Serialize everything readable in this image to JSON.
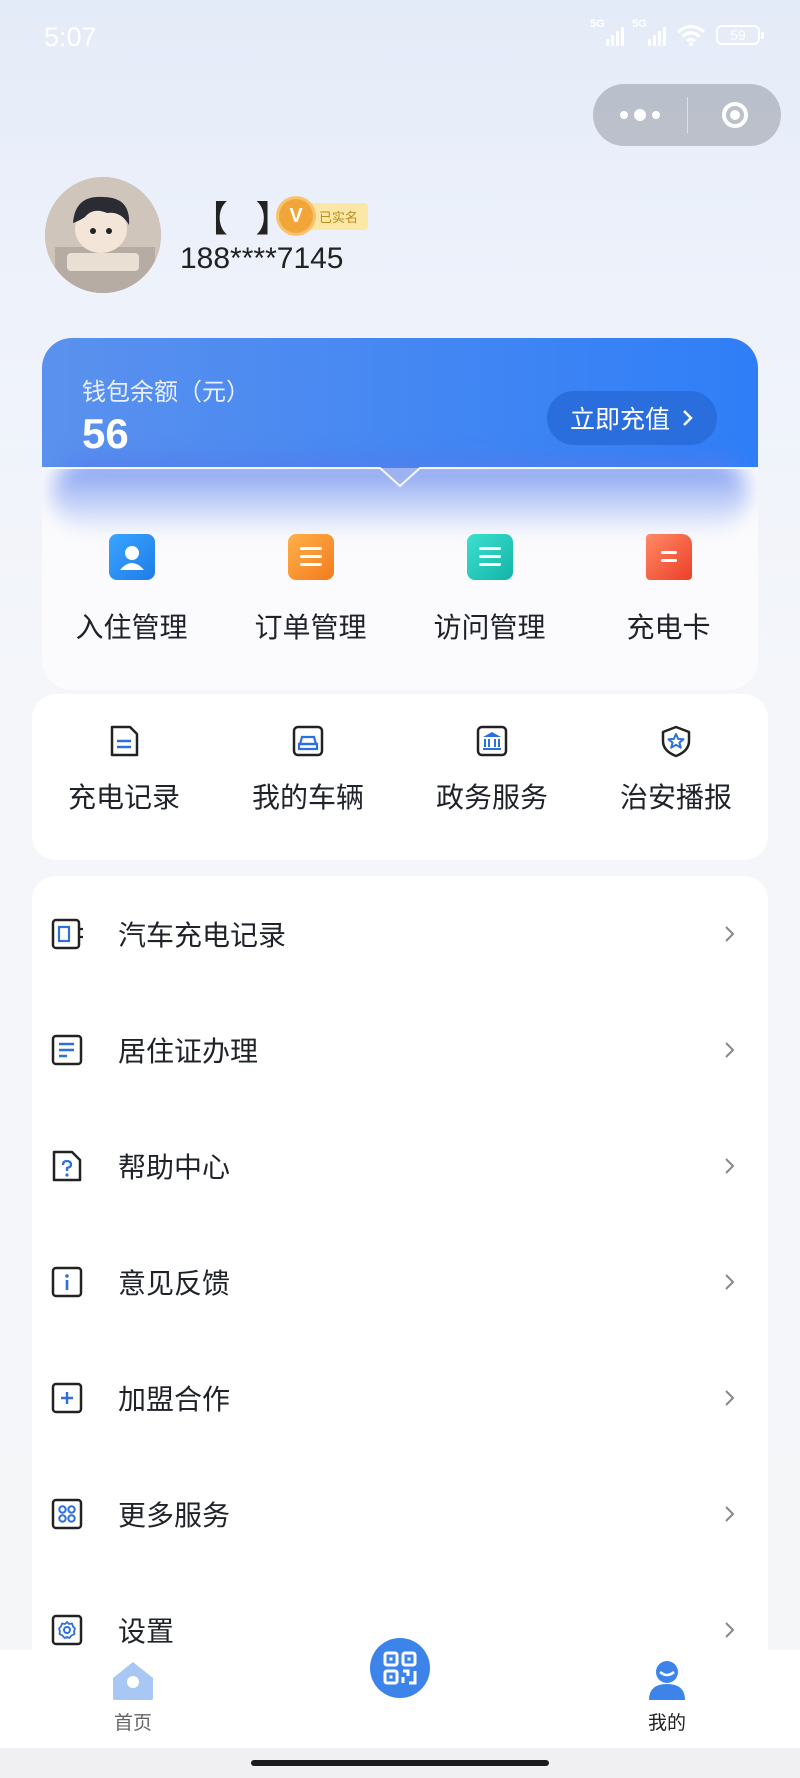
{
  "status_bar": {
    "time": "5:07",
    "signal1": "5G",
    "signal2": "5G",
    "battery": "59"
  },
  "capsule": {
    "more_icon": "more-dots-icon",
    "close_icon": "target-close-icon"
  },
  "profile": {
    "name": "【 】",
    "verified": "已实名",
    "phone": "188****7145"
  },
  "wallet": {
    "label": "钱包余额（元）",
    "amount": "56",
    "recharge": "立即充值"
  },
  "quick_actions": [
    {
      "label": "入住管理",
      "icon": "contact-card-icon",
      "color": "#2b8cf0"
    },
    {
      "label": "订单管理",
      "icon": "orders-icon",
      "color": "#f5922a"
    },
    {
      "label": "访问管理",
      "icon": "visit-icon",
      "color": "#22c4b8"
    },
    {
      "label": "充电卡",
      "icon": "scroll-card-icon",
      "color": "#f2583e"
    }
  ],
  "services": [
    {
      "label": "充电记录",
      "icon": "document-icon"
    },
    {
      "label": "我的车辆",
      "icon": "car-icon"
    },
    {
      "label": "政务服务",
      "icon": "government-icon"
    },
    {
      "label": "治安播报",
      "icon": "shield-star-icon"
    }
  ],
  "menu": [
    {
      "label": "汽车充电记录",
      "icon": "ev-charge-icon"
    },
    {
      "label": "居住证办理",
      "icon": "residence-doc-icon"
    },
    {
      "label": "帮助中心",
      "icon": "help-doc-icon"
    },
    {
      "label": "意见反馈",
      "icon": "info-icon"
    },
    {
      "label": "加盟合作",
      "icon": "plus-box-icon"
    },
    {
      "label": "更多服务",
      "icon": "apps-grid-icon"
    },
    {
      "label": "设置",
      "icon": "settings-gear-icon"
    }
  ],
  "tabbar": {
    "home": "首页",
    "mine": "我的",
    "scan_icon": "qr-scan-icon"
  }
}
